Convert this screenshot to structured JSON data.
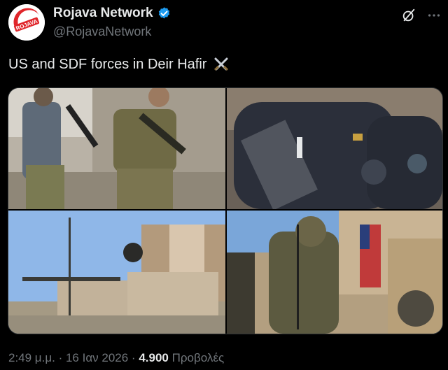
{
  "account": {
    "display_name": "Rojava Network",
    "handle": "@RojavaNetwork",
    "avatar_text": "ROJAVA",
    "verified_icon": "verified-badge-icon"
  },
  "header_icons": {
    "grok": "grok-icon",
    "more": "more-horizontal-icon"
  },
  "tweet": {
    "text": "US and SDF forces in Deir Hafir",
    "emoji_icon": "crossed-swords-icon"
  },
  "media": {
    "photos": [
      "photo-1",
      "photo-2",
      "photo-3",
      "photo-4"
    ]
  },
  "status": {
    "time": "2:49 μ.μ.",
    "sep": " · ",
    "date": "16 Ιαν 2026",
    "views_count": "4.900",
    "views_label": "Προβολές"
  },
  "colors": {
    "background": "#000000",
    "text_primary": "#e7e9ea",
    "text_secondary": "#71767b",
    "verified": "#1d9bf0",
    "avatar_red": "#e0262b"
  }
}
